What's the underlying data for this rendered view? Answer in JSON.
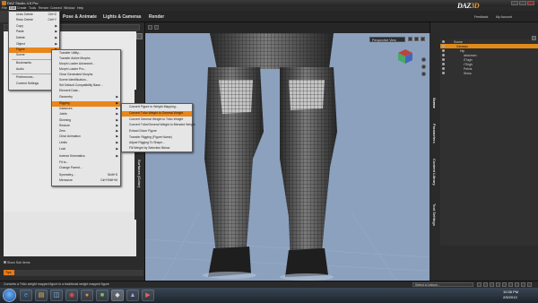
{
  "window": {
    "title": "DAZ Studio 4.5 Pro"
  },
  "menubar": [
    "File",
    "Edit",
    "Create",
    "Tools",
    "Render",
    "Connect",
    "Window",
    "Help"
  ],
  "rooms": [
    "Pose & Animate",
    "Lights & Cameras",
    "Render"
  ],
  "header_links": {
    "brand": "DAZ",
    "brand_3d": "3D",
    "feedback": "Feedback",
    "account": "My Account"
  },
  "edit_menu": {
    "items": [
      {
        "label": "Undo Delete",
        "shortcut": "Ctrl+Z"
      },
      {
        "label": "Redo Delete",
        "shortcut": "Ctrl+Y"
      },
      {
        "label": "Copy"
      },
      {
        "label": "Paste"
      },
      {
        "label": "Delete"
      },
      {
        "label": "Object"
      },
      {
        "label": "Figure"
      },
      {
        "label": "Scene"
      },
      {
        "label": "Bookmarks"
      },
      {
        "label": "Audio"
      },
      {
        "label": "Preferences...",
        "shortcut": "F2"
      },
      {
        "label": "Content Settings"
      }
    ]
  },
  "figure_menu": {
    "items": [
      "Transfer Utility...",
      "Transfer Active Morphs",
      "Morph Loader Advanced...",
      "Morph Loader Pro...",
      "Clear Generated Morphs",
      "Scene Identification...",
      "Set Default Compatibility Base...",
      "Element Data...",
      "Geometry",
      "Rigging",
      "Instances",
      "Joints",
      "Skinning",
      "Restore",
      "Zero",
      "Clear Animation",
      "Limits",
      "Lock",
      "Inverse Kinematics",
      "Fit to...",
      "Change Parent...",
      "Symmetry...",
      "Memorize"
    ],
    "shortcuts": {
      "Symmetry...": "Shift+S",
      "Memorize": "Ctrl+Shift+M"
    }
  },
  "rigging_menu": {
    "items": [
      "Convert Figure to Weight Mapping...",
      "Convert TriAx Weight to General Weight",
      "Convert General Weight to TriAx Weight",
      "Convert TriAx/General Weight to Blended Weight",
      "Extract Dicon Figure",
      "Transfer Rigging (Figure Name)",
      "Adjust Rigging To Shape...",
      "Fill Weight by Selection Below"
    ],
    "highlighted": "Convert TriAx Weight to General Weight"
  },
  "viewport": {
    "mode": "Perspective View"
  },
  "scene": {
    "items": [
      {
        "label": "Scene",
        "selected": false,
        "indent": 0
      },
      {
        "label": "Genesis",
        "selected": true,
        "indent": 1
      },
      {
        "label": "Hip",
        "selected": false,
        "indent": 2
      },
      {
        "label": "abdomen",
        "selected": false,
        "indent": 3
      },
      {
        "label": "lThigh",
        "selected": false,
        "indent": 3
      },
      {
        "label": "rThigh",
        "selected": false,
        "indent": 3
      },
      {
        "label": "Pelvis",
        "selected": false,
        "indent": 3
      },
      {
        "label": "Shins",
        "selected": false,
        "indent": 3
      }
    ]
  },
  "right_tabs": [
    "Scene",
    "Parameters",
    "Content Library",
    "Tool Settings"
  ],
  "left_side_tabs": [
    "Surfaces (Color)"
  ],
  "left_panel": {
    "show_sub_items": "Show Sub Items",
    "tips": "Tips"
  },
  "status": {
    "message": "Converts a TriAx weight mapped figure to a traditional weight mapped figure",
    "lesson": "Select a Lesson..."
  },
  "taskbar": {
    "time": "10:36 PM",
    "date": "2/5/2013",
    "apps": [
      "ie",
      "folder",
      "explorer",
      "chrome",
      "firefox",
      "app",
      "daz",
      "app2",
      "media"
    ]
  }
}
